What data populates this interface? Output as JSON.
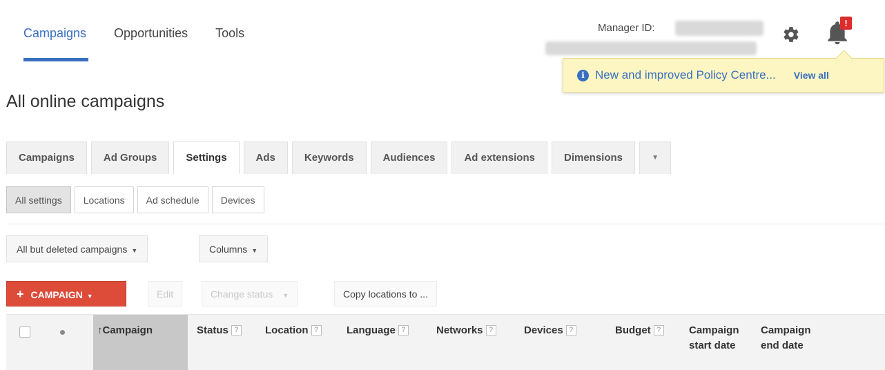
{
  "topnav": {
    "items": [
      {
        "label": "Campaigns",
        "active": true
      },
      {
        "label": "Opportunities",
        "active": false
      },
      {
        "label": "Tools",
        "active": false
      }
    ]
  },
  "account": {
    "manager_label": "Manager ID:"
  },
  "notifications": {
    "badge": "!",
    "message": "New and improved Policy Centre...",
    "view_all": "View all",
    "info_glyph": "i"
  },
  "page": {
    "title": "All online campaigns"
  },
  "tabs": [
    {
      "label": "Campaigns",
      "active": false
    },
    {
      "label": "Ad Groups",
      "active": false
    },
    {
      "label": "Settings",
      "active": true
    },
    {
      "label": "Ads",
      "active": false
    },
    {
      "label": "Keywords",
      "active": false
    },
    {
      "label": "Audiences",
      "active": false
    },
    {
      "label": "Ad extensions",
      "active": false
    },
    {
      "label": "Dimensions",
      "active": false
    }
  ],
  "subtabs": [
    {
      "label": "All settings",
      "active": true
    },
    {
      "label": "Locations",
      "active": false
    },
    {
      "label": "Ad schedule",
      "active": false
    },
    {
      "label": "Devices",
      "active": false
    }
  ],
  "filters": {
    "campaign_filter": "All but deleted campaigns",
    "columns": "Columns"
  },
  "toolbar": {
    "add_campaign": "CAMPAIGN",
    "edit": "Edit",
    "change_status": "Change status",
    "copy_locations": "Copy locations to ..."
  },
  "table": {
    "sort_arrow": "↑",
    "columns": {
      "campaign": "Campaign",
      "status": "Status",
      "location": "Location",
      "language": "Language",
      "networks": "Networks",
      "devices": "Devices",
      "budget": "Budget",
      "start_date_line1": "Campaign",
      "start_date_line2": "start date",
      "end_date_line1": "Campaign",
      "end_date_line2": "end date"
    },
    "help_glyph": "?"
  },
  "colors": {
    "accent": "#3a6fc0",
    "primary_button": "#dd4b39",
    "notice_bg": "#fdf6c3",
    "badge": "#dd2c2c"
  }
}
